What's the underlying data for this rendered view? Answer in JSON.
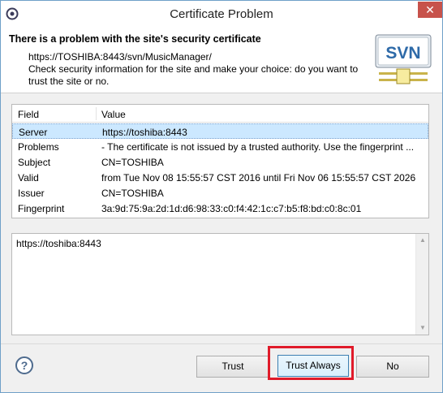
{
  "window": {
    "title": "Certificate Problem",
    "close_glyph": "✕"
  },
  "header": {
    "title": "There is a problem with the site's security certificate",
    "url": "https://TOSHIBA:8443/svn/MusicManager/",
    "message": "Check security information for the site and make your choice: do you want to trust the site or no.",
    "logo_text": "SVN"
  },
  "grid": {
    "columns": [
      "Field",
      "Value"
    ],
    "rows": [
      {
        "field": "Server",
        "value": "https://toshiba:8443",
        "selected": true
      },
      {
        "field": "Problems",
        "value": " - The certificate is not issued by a trusted authority. Use the  fingerprint ...",
        "selected": false
      },
      {
        "field": "Subject",
        "value": "CN=TOSHIBA",
        "selected": false
      },
      {
        "field": "Valid",
        "value": "from Tue Nov 08 15:55:57 CST 2016 until Fri Nov 06 15:55:57 CST 2026",
        "selected": false
      },
      {
        "field": "Issuer",
        "value": "CN=TOSHIBA",
        "selected": false
      },
      {
        "field": "Fingerprint",
        "value": "3a:9d:75:9a:2d:1d:d6:98:33:c0:f4:42:1c:c7:b5:f8:bd:c0:8c:01",
        "selected": false
      }
    ]
  },
  "details": {
    "text": "https://toshiba:8443"
  },
  "buttons": {
    "help_glyph": "?",
    "trust": "Trust",
    "trust_always": "Trust Always",
    "no": "No"
  },
  "colors": {
    "highlight": "#e01b2a",
    "selection": "#cce8ff"
  }
}
